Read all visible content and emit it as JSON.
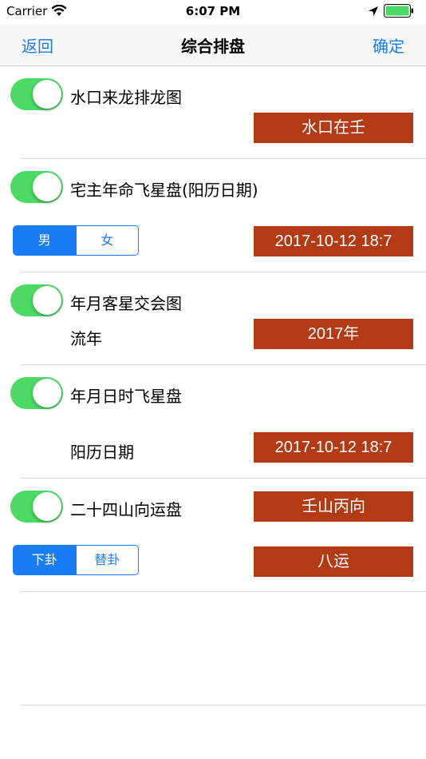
{
  "status_bar": {
    "carrier": "Carrier",
    "time": "6:07 PM"
  },
  "nav": {
    "back": "返回",
    "title": "综合排盘",
    "confirm": "确定"
  },
  "section1": {
    "toggle_on": true,
    "label": "水口来龙排龙图",
    "value": "水口在壬"
  },
  "section2": {
    "toggle_on": true,
    "label": "宅主年命飞星盘(阳历日期)",
    "seg_options": [
      "男",
      "女"
    ],
    "seg_selected": 0,
    "value": "2017-10-12 18:7"
  },
  "section3": {
    "toggle_on": true,
    "label": "年月客星交会图",
    "sublabel": "流年",
    "value": "2017年"
  },
  "section4": {
    "toggle_on": true,
    "label": "年月日时飞星盘",
    "sublabel": "阳历日期",
    "value": "2017-10-12 18:7"
  },
  "section5": {
    "toggle_on": true,
    "label": "二十四山向运盘",
    "value": "壬山丙向",
    "seg_options": [
      "下卦",
      "替卦"
    ],
    "seg_selected": 0,
    "value2": "八运"
  },
  "colors": {
    "accent": "#1a7cf5",
    "toggle_on": "#4cd964",
    "value_box": "#b23a14"
  }
}
